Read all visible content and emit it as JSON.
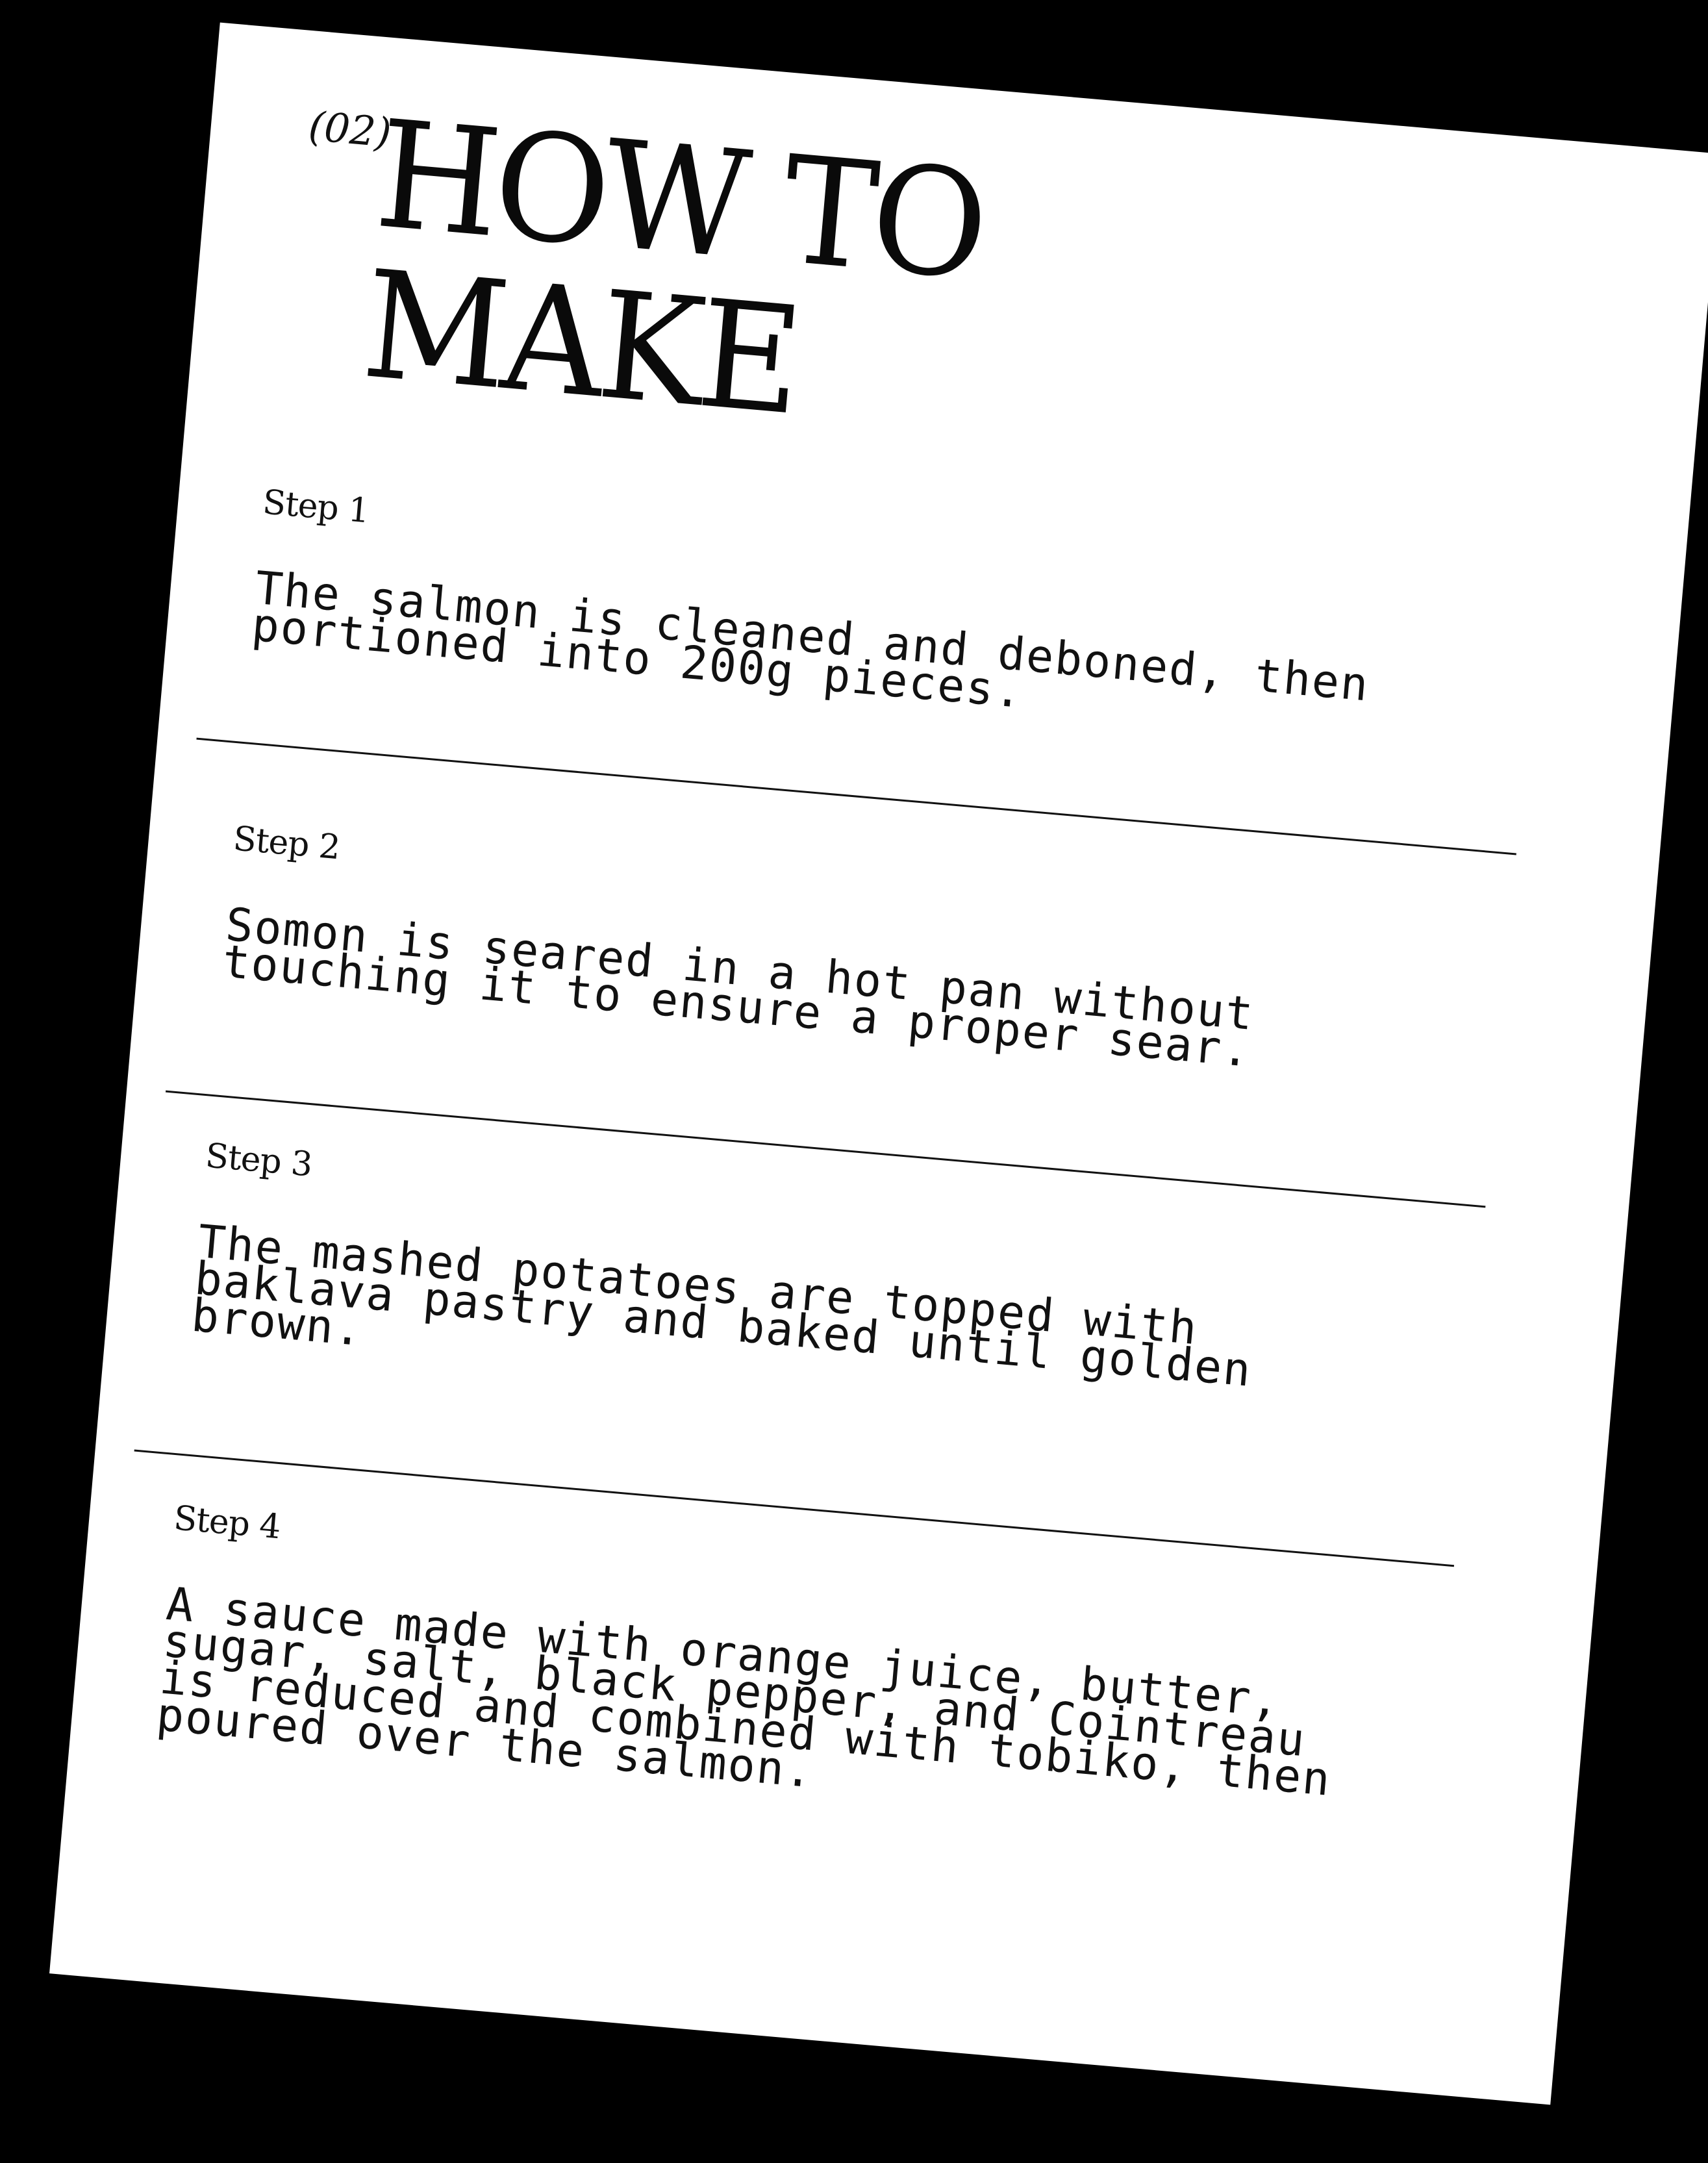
{
  "header": {
    "number": "(02)",
    "title_line1": "HOW TO",
    "title_line2": "MAKE"
  },
  "steps": [
    {
      "label": "Step 1",
      "text": "The salmon is cleaned and deboned, then\nportioned into 200g pieces."
    },
    {
      "label": "Step 2",
      "text": "Somon is seared in a hot pan without\ntouching it to ensure a proper sear."
    },
    {
      "label": "Step 3",
      "text": "The mashed potatoes are topped with\nbaklava pastry and baked until golden\nbrown."
    },
    {
      "label": "Step 4",
      "text": "A sauce made with orange juice, butter,\nsugar, salt, black pepper, and Cointreau\nis reduced and combined with tobiko, then\npoured over the salmon."
    }
  ],
  "colors": {
    "background": "#000000",
    "paper": "#ffffff",
    "ink": "#111111"
  }
}
